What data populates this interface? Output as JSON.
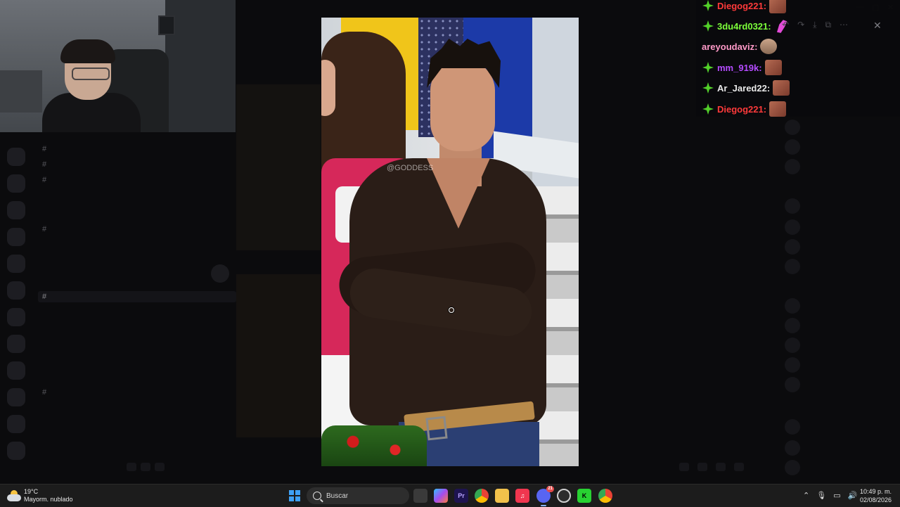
{
  "viewer": {
    "window_title": "",
    "image_watermark": "@GODDESS",
    "controls": [
      "reply",
      "forward",
      "download",
      "open-external",
      "more"
    ],
    "close_label": "✕"
  },
  "discord": {
    "channel_title": "",
    "message_preview": "",
    "channels": [
      {
        "name": "",
        "icon": "hash"
      },
      {
        "name": "",
        "icon": "hash"
      },
      {
        "name": "",
        "icon": "hash"
      },
      {
        "name": "",
        "icon": "hash"
      },
      {
        "name": "",
        "icon": "hash"
      },
      {
        "name": "",
        "icon": "hash"
      }
    ],
    "members": [
      {
        "name": ""
      },
      {
        "name": ""
      },
      {
        "name": ""
      },
      {
        "name": ""
      },
      {
        "name": ""
      },
      {
        "name": ""
      },
      {
        "name": ""
      },
      {
        "name": ""
      },
      {
        "name": ""
      },
      {
        "name": ""
      },
      {
        "name": ""
      },
      {
        "name": ""
      },
      {
        "name": ""
      },
      {
        "name": ""
      },
      {
        "name": ""
      }
    ]
  },
  "stream_chat": {
    "messages": [
      {
        "user": "Diegog221:",
        "color": "#ff3a3a",
        "prime": true,
        "emote": "face-emote"
      },
      {
        "user": "3du4rd0321:",
        "color": "#7cff3a",
        "prime": true,
        "emote": "pink-emote"
      },
      {
        "user": "areyoudaviz:",
        "color": "#ff9ac8",
        "prime": false,
        "emote": "face-emote-2"
      },
      {
        "user": "mm_919k:",
        "color": "#b44bff",
        "prime": true,
        "emote": "face-emote"
      },
      {
        "user": "Ar_Jared22:",
        "color": "#e8e8e8",
        "prime": true,
        "emote": "face-emote"
      },
      {
        "user": "Diegog221:",
        "color": "#ff3a3a",
        "prime": true,
        "emote": "face-emote"
      }
    ]
  },
  "taskbar": {
    "weather_temp": "19°C",
    "weather_desc": "Mayorm. nublado",
    "search_label": "Buscar",
    "apps": [
      {
        "name": "task-view",
        "label": "",
        "color": "#3a3a3a"
      },
      {
        "name": "copilot",
        "label": "",
        "color": "#7a5cf0"
      },
      {
        "name": "premiere",
        "label": "Pr",
        "color": "#1e1450"
      },
      {
        "name": "chrome",
        "label": "",
        "color": "#e9a93a"
      },
      {
        "name": "file-explorer",
        "label": "",
        "color": "#f2c14b"
      },
      {
        "name": "music",
        "label": "♫",
        "color": "#f0364f"
      },
      {
        "name": "discord",
        "label": "",
        "color": "#5865f2",
        "badge": "21"
      },
      {
        "name": "obs",
        "label": "",
        "color": "#2d2d2d"
      },
      {
        "name": "kick",
        "label": "K",
        "color": "#28d232"
      },
      {
        "name": "chrome-profile",
        "label": "",
        "color": "#4aa3e6"
      }
    ],
    "clock_time": "10:49 p. m.",
    "clock_date": "02/08/2026"
  }
}
